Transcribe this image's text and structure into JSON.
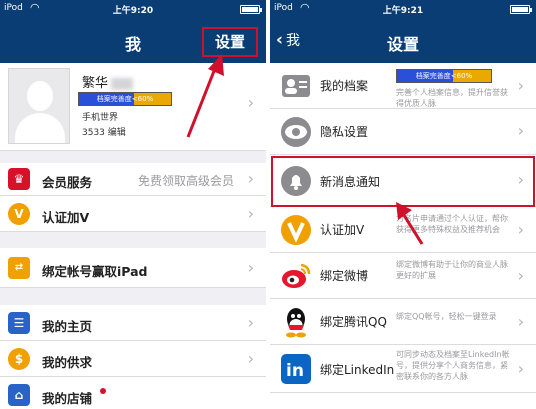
{
  "left": {
    "status": {
      "carrier": "iPod",
      "time": "上午9:20"
    },
    "nav": {
      "title": "我",
      "settings_label": "设置"
    },
    "profile": {
      "name": "繁华",
      "progress_label": "档案完善度<60%",
      "progress": 0.6,
      "line1": "手机世界",
      "line2": "3533 编辑"
    },
    "items": [
      {
        "label": "会员服务",
        "sub": "免费领取高级会员",
        "icon": "crown-icon",
        "color": "#d8102a"
      },
      {
        "label": "认证加V",
        "sub": "",
        "icon": "v-badge-icon",
        "color": "#f0a000"
      },
      {
        "label": "绑定帐号赢取iPad",
        "sub": "",
        "icon": "link-icon",
        "color": "#f0a000"
      },
      {
        "label": "我的主页",
        "sub": "",
        "icon": "list-icon",
        "color": "#2a63c8"
      },
      {
        "label": "我的供求",
        "sub": "",
        "icon": "coin-icon",
        "color": "#f0a000"
      },
      {
        "label": "我的店铺",
        "sub": "",
        "icon": "store-icon",
        "color": "#2a63c8"
      }
    ]
  },
  "right": {
    "status": {
      "carrier": "iPod",
      "time": "上午9:21"
    },
    "nav": {
      "title": "设置",
      "back_label": "我"
    },
    "items": [
      {
        "label": "我的档案",
        "progress_label": "档案完善度<60%",
        "progress": 0.6,
        "desc": "完善个人档案信息，提升信誉获得优质人脉",
        "icon": "profile-card-icon"
      },
      {
        "label": "隐私设置",
        "desc": "",
        "icon": "eye-icon"
      },
      {
        "label": "新消息通知",
        "desc": "",
        "icon": "notification-bell-icon"
      },
      {
        "label": "认证加V",
        "desc": "为名片申请通过个人认证，帮你获得更多特殊权益及推荐机会",
        "icon": "v-badge-icon"
      },
      {
        "label": "绑定微博",
        "desc": "绑定微博有助于让你的商业人脉更好的扩展",
        "icon": "weibo-icon"
      },
      {
        "label": "绑定腾讯QQ",
        "desc": "绑定QQ帐号，轻松一键登录",
        "icon": "qq-icon"
      },
      {
        "label": "绑定LinkedIn",
        "desc": "可同步动态及档案至LinkedIn帐号，提供分享个人商务信息，紧密联系你的各方人脉",
        "icon": "linkedin-icon"
      }
    ]
  },
  "colors": {
    "navbar": "#0a3d73",
    "highlight": "#d0112b",
    "background": "#efeff4"
  }
}
